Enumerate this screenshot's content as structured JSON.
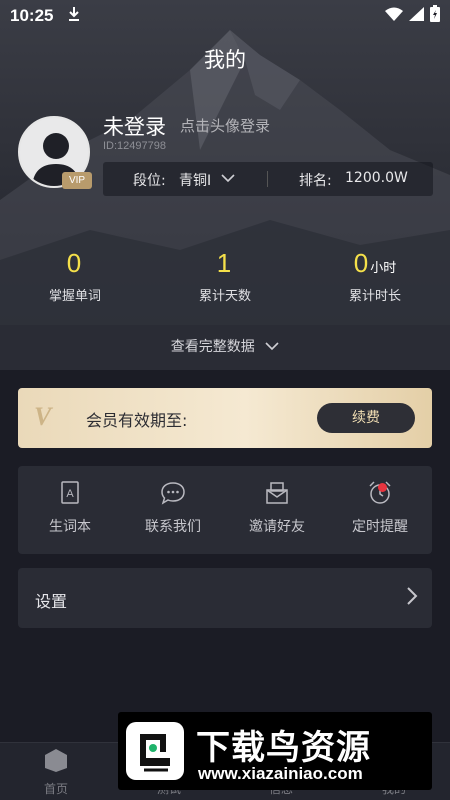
{
  "status_bar": {
    "time": "10:25"
  },
  "header": {
    "title": "我的"
  },
  "profile": {
    "name": "未登录",
    "login_hint": "点击头像登录",
    "user_id": "ID:12497798",
    "vip_badge": "VIP",
    "level_label": "段位:",
    "level_value": "青铜I",
    "rank_label": "排名:",
    "rank_value": "1200.0W"
  },
  "stats": [
    {
      "value": "0",
      "unit": "",
      "label": "掌握单词"
    },
    {
      "value": "1",
      "unit": "",
      "label": "累计天数"
    },
    {
      "value": "0",
      "unit": "小时",
      "label": "累计时长"
    }
  ],
  "view_full_data": "查看完整数据",
  "membership": {
    "logo": "V",
    "text": "会员有效期至:",
    "renew_label": "续费"
  },
  "tools": [
    {
      "label": "生词本",
      "icon": "vocabulary-book-icon"
    },
    {
      "label": "联系我们",
      "icon": "chat-bubble-icon"
    },
    {
      "label": "邀请好友",
      "icon": "invite-envelope-icon"
    },
    {
      "label": "定时提醒",
      "icon": "alarm-clock-icon"
    }
  ],
  "settings": {
    "label": "设置"
  },
  "tabbar": {
    "items": [
      {
        "label": "首页",
        "icon": "home-icon"
      },
      {
        "label": "测试",
        "icon": "test-icon"
      },
      {
        "label": "信息",
        "icon": "message-icon"
      },
      {
        "label": "我的",
        "icon": "profile-icon"
      }
    ]
  },
  "watermark": {
    "title": "下载鸟资源",
    "url": "www.xiazainiao.com"
  },
  "colors": {
    "accent_yellow": "#f5e04a",
    "background": "#1b1c25",
    "card": "#2a2c35",
    "gold": "#ead9b9",
    "red_dot": "#e8343f"
  }
}
